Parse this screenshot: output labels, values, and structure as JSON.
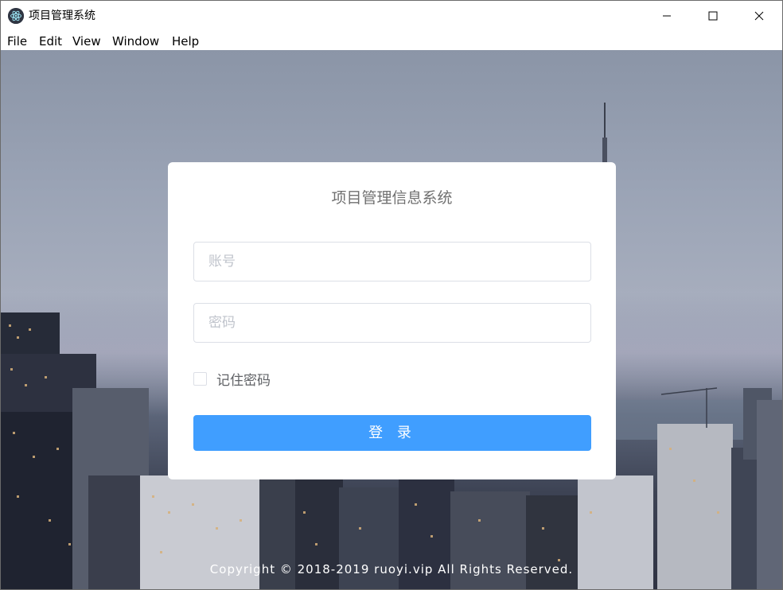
{
  "window": {
    "title": "项目管理系统",
    "app_icon": "electron-atom-icon"
  },
  "menubar": {
    "items": [
      "File",
      "Edit",
      "View",
      "Window",
      "Help"
    ]
  },
  "login": {
    "title": "项目管理信息系统",
    "username_placeholder": "账号",
    "password_placeholder": "密码",
    "remember_label": "记住密码",
    "remember_checked": false,
    "submit_label": "登 录"
  },
  "footer": {
    "copyright": "Copyright © 2018-2019 ruoyi.vip All Rights Reserved."
  },
  "colors": {
    "primary": "#409eff",
    "card_bg": "#ffffff"
  }
}
